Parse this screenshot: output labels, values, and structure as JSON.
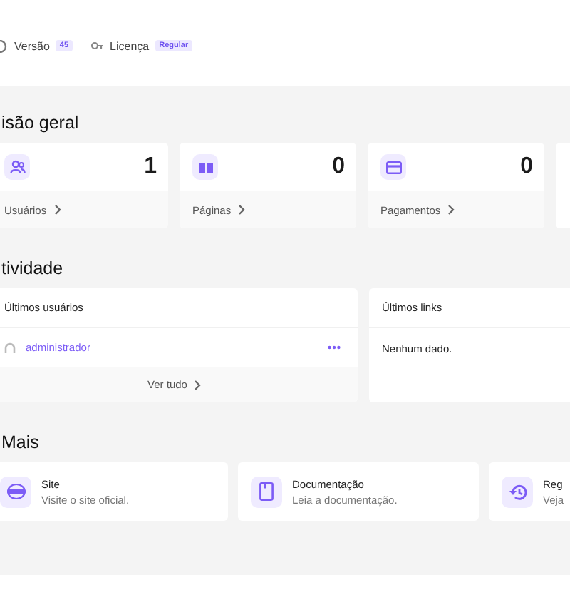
{
  "header": {
    "items": [
      {
        "label": "Versão",
        "badge": "45"
      },
      {
        "label": "Licença",
        "badge": "Regular"
      }
    ]
  },
  "overview": {
    "title": "isão geral",
    "cards": [
      {
        "kind": "stat",
        "value": "1",
        "label": "Usuários"
      },
      {
        "kind": "stat",
        "value": "0",
        "label": "Páginas"
      },
      {
        "kind": "stat",
        "value": "0",
        "label": "Pagamentos"
      },
      {
        "kind": "cut"
      }
    ]
  },
  "activity": {
    "title": "tividade",
    "users": {
      "title": "Últimos usuários",
      "rows": [
        {
          "name": "administrador"
        }
      ],
      "footer": "Ver tudo"
    },
    "links": {
      "title": "Últimos links",
      "empty": "Nenhum dado."
    }
  },
  "more": {
    "title": "Mais",
    "items": [
      {
        "title": "Site",
        "desc": "Visite o site oficial."
      },
      {
        "title": "Documentação",
        "desc": "Leia a documentação."
      },
      {
        "title": "Reg",
        "desc": "Veja"
      }
    ]
  }
}
